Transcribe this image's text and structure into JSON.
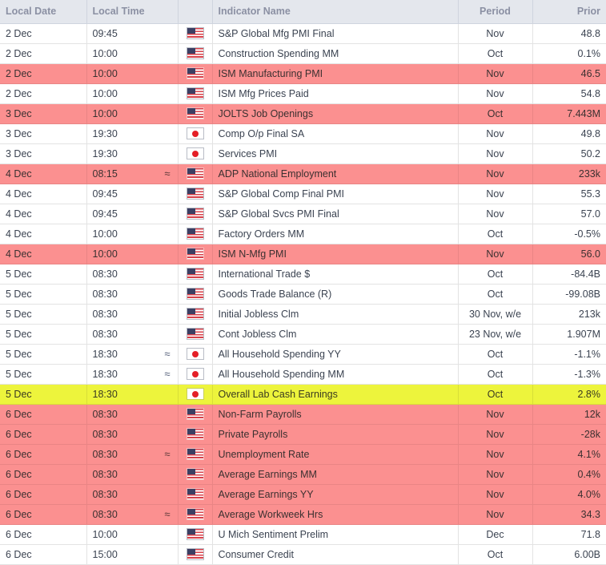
{
  "table": {
    "columns": [
      {
        "key": "date",
        "label": "Local Date",
        "align": "left"
      },
      {
        "key": "time",
        "label": "Local Time",
        "align": "left"
      },
      {
        "key": "flag",
        "label": "",
        "align": "center"
      },
      {
        "key": "indicator",
        "label": "Indicator Name",
        "align": "left"
      },
      {
        "key": "period",
        "label": "Period",
        "align": "center"
      },
      {
        "key": "prior",
        "label": "Prior",
        "align": "right"
      }
    ],
    "colors": {
      "header_bg": "#e4e7ed",
      "header_text": "#8b90a3",
      "row_bg": "#ffffff",
      "row_text": "#3b4351",
      "highlight_pink": "#fb9090",
      "highlight_yellow": "#edf43c",
      "grid_line": "#e3e3e3"
    },
    "rows": [
      {
        "date": "2 Dec",
        "time": "09:45",
        "approx": false,
        "flag": "us-flag-icon",
        "indicator": "S&P Global Mfg PMI Final",
        "period": "Nov",
        "prior": "48.8",
        "highlight": "none"
      },
      {
        "date": "2 Dec",
        "time": "10:00",
        "approx": false,
        "flag": "us-flag-icon",
        "indicator": "Construction Spending MM",
        "period": "Oct",
        "prior": "0.1%",
        "highlight": "none"
      },
      {
        "date": "2 Dec",
        "time": "10:00",
        "approx": false,
        "flag": "us-flag-icon",
        "indicator": "ISM Manufacturing PMI",
        "period": "Nov",
        "prior": "46.5",
        "highlight": "pink"
      },
      {
        "date": "2 Dec",
        "time": "10:00",
        "approx": false,
        "flag": "us-flag-icon",
        "indicator": "ISM Mfg Prices Paid",
        "period": "Nov",
        "prior": "54.8",
        "highlight": "none"
      },
      {
        "date": "3 Dec",
        "time": "10:00",
        "approx": false,
        "flag": "us-flag-icon",
        "indicator": "JOLTS Job Openings",
        "period": "Oct",
        "prior": "7.443M",
        "highlight": "pink"
      },
      {
        "date": "3 Dec",
        "time": "19:30",
        "approx": false,
        "flag": "jp-flag-icon",
        "indicator": "Comp O/p Final SA",
        "period": "Nov",
        "prior": "49.8",
        "highlight": "none"
      },
      {
        "date": "3 Dec",
        "time": "19:30",
        "approx": false,
        "flag": "jp-flag-icon",
        "indicator": "Services PMI",
        "period": "Nov",
        "prior": "50.2",
        "highlight": "none"
      },
      {
        "date": "4 Dec",
        "time": "08:15",
        "approx": true,
        "flag": "us-flag-icon",
        "indicator": "ADP National Employment",
        "period": "Nov",
        "prior": "233k",
        "highlight": "pink"
      },
      {
        "date": "4 Dec",
        "time": "09:45",
        "approx": false,
        "flag": "us-flag-icon",
        "indicator": "S&P Global Comp Final PMI",
        "period": "Nov",
        "prior": "55.3",
        "highlight": "none"
      },
      {
        "date": "4 Dec",
        "time": "09:45",
        "approx": false,
        "flag": "us-flag-icon",
        "indicator": "S&P Global Svcs PMI Final",
        "period": "Nov",
        "prior": "57.0",
        "highlight": "none"
      },
      {
        "date": "4 Dec",
        "time": "10:00",
        "approx": false,
        "flag": "us-flag-icon",
        "indicator": "Factory Orders MM",
        "period": "Oct",
        "prior": "-0.5%",
        "highlight": "none"
      },
      {
        "date": "4 Dec",
        "time": "10:00",
        "approx": false,
        "flag": "us-flag-icon",
        "indicator": "ISM N-Mfg PMI",
        "period": "Nov",
        "prior": "56.0",
        "highlight": "pink"
      },
      {
        "date": "5 Dec",
        "time": "08:30",
        "approx": false,
        "flag": "us-flag-icon",
        "indicator": "International Trade $",
        "period": "Oct",
        "prior": "-84.4B",
        "highlight": "none"
      },
      {
        "date": "5 Dec",
        "time": "08:30",
        "approx": false,
        "flag": "us-flag-icon",
        "indicator": "Goods Trade Balance (R)",
        "period": "Oct",
        "prior": "-99.08B",
        "highlight": "none"
      },
      {
        "date": "5 Dec",
        "time": "08:30",
        "approx": false,
        "flag": "us-flag-icon",
        "indicator": "Initial Jobless Clm",
        "period": "30 Nov, w/e",
        "prior": "213k",
        "highlight": "none"
      },
      {
        "date": "5 Dec",
        "time": "08:30",
        "approx": false,
        "flag": "us-flag-icon",
        "indicator": "Cont Jobless Clm",
        "period": "23 Nov, w/e",
        "prior": "1.907M",
        "highlight": "none"
      },
      {
        "date": "5 Dec",
        "time": "18:30",
        "approx": true,
        "flag": "jp-flag-icon",
        "indicator": "All Household Spending YY",
        "period": "Oct",
        "prior": "-1.1%",
        "highlight": "none"
      },
      {
        "date": "5 Dec",
        "time": "18:30",
        "approx": true,
        "flag": "jp-flag-icon",
        "indicator": "All Household Spending MM",
        "period": "Oct",
        "prior": "-1.3%",
        "highlight": "none"
      },
      {
        "date": "5 Dec",
        "time": "18:30",
        "approx": false,
        "flag": "jp-flag-icon",
        "indicator": "Overall Lab Cash Earnings",
        "period": "Oct",
        "prior": "2.8%",
        "highlight": "yellow"
      },
      {
        "date": "6 Dec",
        "time": "08:30",
        "approx": false,
        "flag": "us-flag-icon",
        "indicator": "Non-Farm Payrolls",
        "period": "Nov",
        "prior": "12k",
        "highlight": "pink"
      },
      {
        "date": "6 Dec",
        "time": "08:30",
        "approx": false,
        "flag": "us-flag-icon",
        "indicator": "Private Payrolls",
        "period": "Nov",
        "prior": "-28k",
        "highlight": "pink"
      },
      {
        "date": "6 Dec",
        "time": "08:30",
        "approx": true,
        "flag": "us-flag-icon",
        "indicator": "Unemployment Rate",
        "period": "Nov",
        "prior": "4.1%",
        "highlight": "pink"
      },
      {
        "date": "6 Dec",
        "time": "08:30",
        "approx": false,
        "flag": "us-flag-icon",
        "indicator": "Average Earnings MM",
        "period": "Nov",
        "prior": "0.4%",
        "highlight": "pink"
      },
      {
        "date": "6 Dec",
        "time": "08:30",
        "approx": false,
        "flag": "us-flag-icon",
        "indicator": "Average Earnings YY",
        "period": "Nov",
        "prior": "4.0%",
        "highlight": "pink"
      },
      {
        "date": "6 Dec",
        "time": "08:30",
        "approx": true,
        "flag": "us-flag-icon",
        "indicator": "Average Workweek Hrs",
        "period": "Nov",
        "prior": "34.3",
        "highlight": "pink"
      },
      {
        "date": "6 Dec",
        "time": "10:00",
        "approx": false,
        "flag": "us-flag-icon",
        "indicator": "U Mich Sentiment Prelim",
        "period": "Dec",
        "prior": "71.8",
        "highlight": "none"
      },
      {
        "date": "6 Dec",
        "time": "15:00",
        "approx": false,
        "flag": "us-flag-icon",
        "indicator": "Consumer Credit",
        "period": "Oct",
        "prior": "6.00B",
        "highlight": "none"
      }
    ],
    "approx_symbol": "≈"
  }
}
